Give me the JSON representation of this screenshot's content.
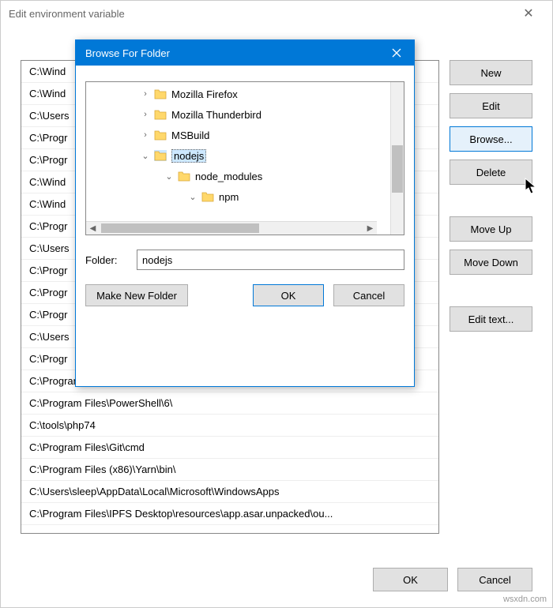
{
  "main_dialog": {
    "title": "Edit environment variable",
    "paths": [
      "C:\\Wind",
      "C:\\Wind",
      "C:\\Users",
      "C:\\Progr",
      "C:\\Progr",
      "C:\\Wind",
      "C:\\Wind",
      "C:\\Progr",
      "C:\\Users",
      "C:\\Progr",
      "C:\\Progr",
      "C:\\Progr",
      "C:\\Users",
      "C:\\Progr",
      "C:\\Program Files\\PuTTY\\",
      "C:\\Program Files\\PowerShell\\6\\",
      "C:\\tools\\php74",
      "C:\\Program Files\\Git\\cmd",
      "C:\\Program Files (x86)\\Yarn\\bin\\",
      "C:\\Users\\sleep\\AppData\\Local\\Microsoft\\WindowsApps",
      "C:\\Program Files\\IPFS Desktop\\resources\\app.asar.unpacked\\ou..."
    ],
    "buttons": {
      "new": "New",
      "edit": "Edit",
      "browse": "Browse...",
      "delete": "Delete",
      "move_up": "Move Up",
      "move_down": "Move Down",
      "edit_text": "Edit text..."
    },
    "ok": "OK",
    "cancel": "Cancel"
  },
  "browse_dialog": {
    "title": "Browse For Folder",
    "tree": [
      {
        "indent": 60,
        "expander": "›",
        "label": "Mozilla Firefox",
        "selected": false
      },
      {
        "indent": 60,
        "expander": "›",
        "label": "Mozilla Thunderbird",
        "selected": false
      },
      {
        "indent": 60,
        "expander": "›",
        "label": "MSBuild",
        "selected": false
      },
      {
        "indent": 60,
        "expander": "⌄",
        "label": "nodejs",
        "selected": true
      },
      {
        "indent": 90,
        "expander": "⌄",
        "label": "node_modules",
        "selected": false
      },
      {
        "indent": 120,
        "expander": "⌄",
        "label": "npm",
        "selected": false
      }
    ],
    "folder_label": "Folder:",
    "folder_value": "nodejs",
    "make_new_folder": "Make New Folder",
    "ok": "OK",
    "cancel": "Cancel"
  },
  "watermark": "wsxdn.com"
}
